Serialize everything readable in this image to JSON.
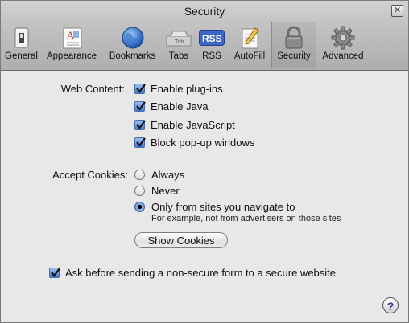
{
  "window": {
    "title": "Security",
    "close_label": "✕"
  },
  "toolbar": [
    {
      "label": "General",
      "icon": "general-switch-icon"
    },
    {
      "label": "Appearance",
      "icon": "appearance-font-icon"
    },
    {
      "label": "Bookmarks",
      "icon": "bookmarks-globe-icon"
    },
    {
      "label": "Tabs",
      "icon": "tabs-icon"
    },
    {
      "label": "RSS",
      "icon": "rss-icon"
    },
    {
      "label": "AutoFill",
      "icon": "autofill-pencil-icon"
    },
    {
      "label": "Security",
      "icon": "lock-icon",
      "selected": true
    },
    {
      "label": "Advanced",
      "icon": "gear-icon"
    }
  ],
  "web_content": {
    "label": "Web Content:",
    "options": [
      {
        "label": "Enable plug-ins",
        "checked": true
      },
      {
        "label": "Enable Java",
        "checked": true
      },
      {
        "label": "Enable JavaScript",
        "checked": true
      },
      {
        "label": "Block pop-up windows",
        "checked": true
      }
    ]
  },
  "cookies": {
    "label": "Accept Cookies:",
    "options": [
      {
        "label": "Always",
        "selected": false
      },
      {
        "label": "Never",
        "selected": false
      },
      {
        "label": "Only from sites you navigate to",
        "selected": true
      }
    ],
    "hint": "For example, not from advertisers on those sites",
    "show_button": "Show Cookies"
  },
  "nonsecure_form": {
    "label": "Ask before sending a non-secure form to a secure website",
    "checked": true
  },
  "help": {
    "label": "?"
  },
  "tabs_icon_text": "Tab",
  "rss_icon_text": "RSS"
}
